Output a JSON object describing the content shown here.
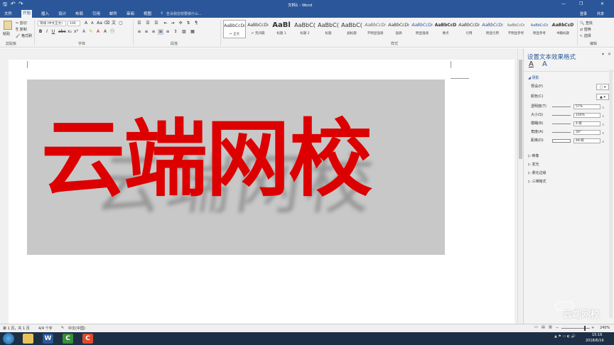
{
  "titlebar": {
    "title": "文档1 - Word",
    "minimize": "—",
    "restore": "❐",
    "close": "✕",
    "undo": "↶",
    "redo": "↷",
    "save": "🖫"
  },
  "tabs": {
    "items": [
      "文件",
      "开始",
      "插入",
      "设计",
      "布局",
      "引用",
      "邮件",
      "审阅",
      "视图"
    ],
    "search_placeholder": "告诉我您想要做什么...",
    "login": "登录",
    "share": "共享"
  },
  "ribbon": {
    "clipboard": {
      "paste": "粘贴",
      "cut": "剪切",
      "copy": "复制",
      "format_painter": "格式刷",
      "label": "剪贴板"
    },
    "font": {
      "name": "等线 (中文正文)",
      "size": "100",
      "label": "字体"
    },
    "paragraph": {
      "label": "段落"
    },
    "styles": {
      "label": "样式",
      "items": [
        {
          "preview": "AaBbCcDı",
          "name": "↵ 正文"
        },
        {
          "preview": "AaBbCcDı",
          "name": "↵ 无间隔"
        },
        {
          "preview": "AaBl",
          "name": "标题 1"
        },
        {
          "preview": "AaBbC(",
          "name": "标题 2"
        },
        {
          "preview": "AaBbC(",
          "name": "标题"
        },
        {
          "preview": "AaBbC(",
          "name": "副标题"
        },
        {
          "preview": "AaBbCcDı",
          "name": "不明显强调"
        },
        {
          "preview": "AaBbCcDı",
          "name": "强调"
        },
        {
          "preview": "AaBbCcDı",
          "name": "明显强调"
        },
        {
          "preview": "AaBbCcD",
          "name": "要点"
        },
        {
          "preview": "AaBbCcDı",
          "name": "引用"
        },
        {
          "preview": "AaBbCcDı",
          "name": "明显引用"
        },
        {
          "preview": "AaBbCcDı",
          "name": "不明显参考"
        },
        {
          "preview": "AaBbCcDı",
          "name": "明显参考"
        },
        {
          "preview": "AaBbCcD",
          "name": "书籍标题"
        }
      ]
    },
    "editing": {
      "find": "查找",
      "replace": "替换",
      "select": "选择",
      "label": "编辑"
    }
  },
  "document": {
    "text": "云端网校"
  },
  "pane": {
    "title": "设置文本效果格式",
    "close": "✕",
    "section_shadow": "阴影",
    "rows": [
      {
        "label": "预设(P)"
      },
      {
        "label": "颜色(C)"
      },
      {
        "label": "透明度(T)",
        "value": "57%"
      },
      {
        "label": "大小(S)",
        "value": "100%"
      },
      {
        "label": "模糊(B)",
        "value": "4 磅"
      },
      {
        "label": "角度(A)",
        "value": "30°"
      },
      {
        "label": "距离(D)",
        "value": "48 磅"
      }
    ],
    "sections": [
      "映像",
      "发光",
      "柔化边缘",
      "三维格式"
    ]
  },
  "status": {
    "page": "第 1 页，共 1 页",
    "words": "4/4 个字",
    "lang": "中文(中国)",
    "zoom": "240%"
  },
  "taskbar": {
    "time": "15:16",
    "date": "2018/6/16",
    "watermark": "云端网校"
  }
}
